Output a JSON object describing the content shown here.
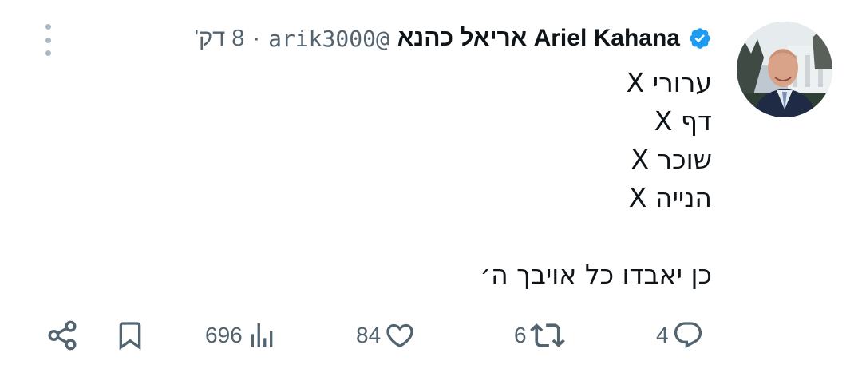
{
  "author": {
    "name": "Ariel Kahana אריאל כהנא",
    "handle": "@arik3000",
    "separator": "·",
    "time": "8 דק'",
    "verified": true
  },
  "tweet": {
    "lines": [
      "ערורי X",
      "דף X",
      "שוכר X",
      "הנייה X",
      "",
      "כן יאבדו כל אויבך ה׳"
    ]
  },
  "actions": {
    "replies": "4",
    "retweets": "6",
    "likes": "84",
    "views": "696"
  },
  "colors": {
    "text": "#0f1419",
    "muted": "#536471",
    "verified": "#1d9bf0"
  },
  "icons": {
    "menu": "more-vertical-icon",
    "reply": "reply-icon",
    "retweet": "retweet-icon",
    "like": "heart-icon",
    "views": "views-bar-icon",
    "bookmark": "bookmark-icon",
    "share": "share-icon"
  }
}
